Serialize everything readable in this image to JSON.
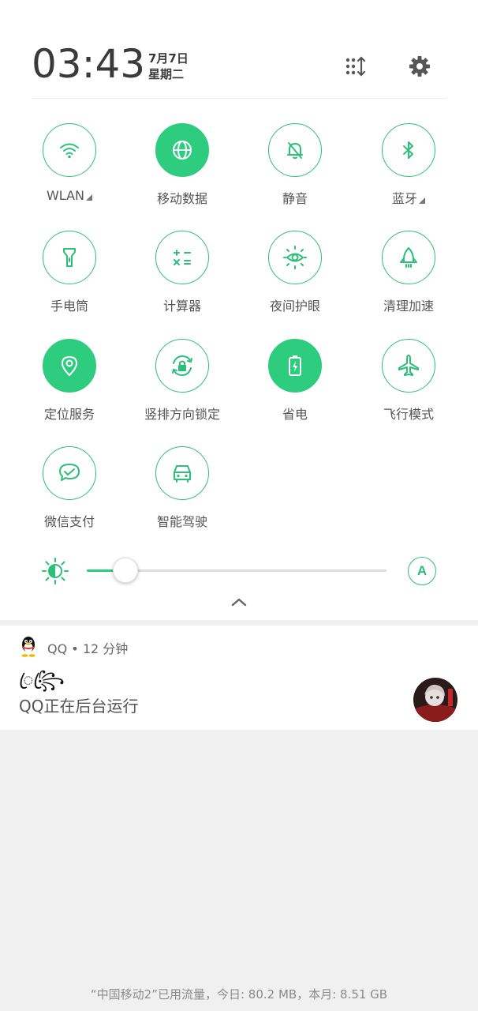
{
  "header": {
    "time": "03:43",
    "date": "7月7日",
    "weekday": "星期二",
    "edit_icon": "edit-tiles-icon",
    "settings_icon": "gear-icon"
  },
  "tiles": [
    {
      "label": "WLAN",
      "icon": "wifi-icon",
      "active": false,
      "has_submenu": true
    },
    {
      "label": "移动数据",
      "icon": "globe-icon",
      "active": true,
      "has_submenu": false
    },
    {
      "label": "静音",
      "icon": "bell-off-icon",
      "active": false,
      "has_submenu": false
    },
    {
      "label": "蓝牙",
      "icon": "bluetooth-icon",
      "active": false,
      "has_submenu": true
    },
    {
      "label": "手电筒",
      "icon": "flashlight-icon",
      "active": false,
      "has_submenu": false
    },
    {
      "label": "计算器",
      "icon": "calculator-icon",
      "active": false,
      "has_submenu": false
    },
    {
      "label": "夜间护眼",
      "icon": "eye-sun-icon",
      "active": false,
      "has_submenu": false
    },
    {
      "label": "清理加速",
      "icon": "rocket-icon",
      "active": false,
      "has_submenu": false
    },
    {
      "label": "定位服务",
      "icon": "location-icon",
      "active": true,
      "has_submenu": false
    },
    {
      "label": "竖排方向锁定",
      "icon": "rotation-lock-icon",
      "active": false,
      "has_submenu": false
    },
    {
      "label": "省电",
      "icon": "battery-saver-icon",
      "active": true,
      "has_submenu": false
    },
    {
      "label": "飞行模式",
      "icon": "airplane-icon",
      "active": false,
      "has_submenu": false
    },
    {
      "label": "微信支付",
      "icon": "wechat-pay-icon",
      "active": false,
      "has_submenu": false
    },
    {
      "label": "智能驾驶",
      "icon": "car-icon",
      "active": false,
      "has_submenu": false
    }
  ],
  "brightness": {
    "level": 0.13,
    "auto_label": "A"
  },
  "notification": {
    "app": "QQ",
    "separator": "•",
    "time": "12 分钟",
    "title": "ꦿ꧂ꦿ",
    "body": "QQ正在后台运行"
  },
  "footer": {
    "text": "“中国移动2”已用流量，今日: 80.2 MB，本月: 8.51 GB"
  },
  "colors": {
    "accent": "#2ecc7f",
    "panel_bg": "#ffffff",
    "page_bg": "#f0f0f0"
  }
}
